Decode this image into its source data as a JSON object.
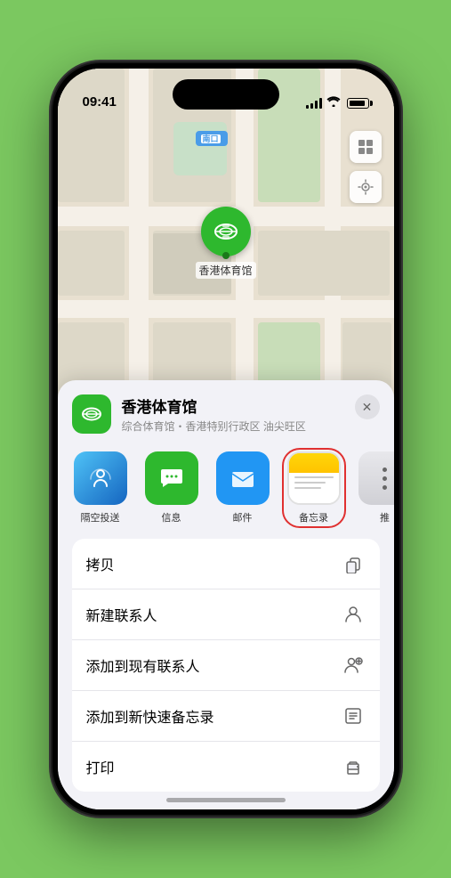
{
  "statusBar": {
    "time": "09:41",
    "locationArrow": "▶"
  },
  "map": {
    "label": "南口",
    "labelPrefix": "南口"
  },
  "venue": {
    "name": "香港体育馆",
    "subtitle": "综合体育馆・香港特别行政区 油尖旺区",
    "pinLabel": "香港体育馆"
  },
  "shareItems": [
    {
      "id": "airdrop",
      "label": "隔空投送",
      "type": "airdrop"
    },
    {
      "id": "messages",
      "label": "信息",
      "type": "messages"
    },
    {
      "id": "mail",
      "label": "邮件",
      "type": "mail"
    },
    {
      "id": "notes",
      "label": "备忘录",
      "type": "notes",
      "selected": true
    },
    {
      "id": "more",
      "label": "推",
      "type": "more"
    }
  ],
  "actionItems": [
    {
      "id": "copy",
      "label": "拷贝",
      "icon": "copy"
    },
    {
      "id": "new-contact",
      "label": "新建联系人",
      "icon": "person"
    },
    {
      "id": "add-existing",
      "label": "添加到现有联系人",
      "icon": "person-add"
    },
    {
      "id": "quick-note",
      "label": "添加到新快速备忘录",
      "icon": "note"
    },
    {
      "id": "print",
      "label": "打印",
      "icon": "print"
    }
  ],
  "closeButton": "✕"
}
